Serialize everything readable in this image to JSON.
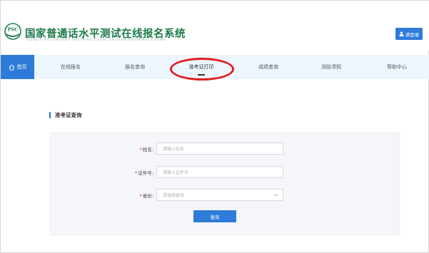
{
  "header": {
    "logo_text": "PSC",
    "title": "国家普通话水平测试在线报名系统",
    "subtitle": "GUOJIA PUTONGHUA SHUIPING CESHI ZAIXIAN BAOMING XITONG",
    "login_label": "请登录",
    "login_icon": "user-icon"
  },
  "nav": {
    "home": {
      "label": "首页",
      "icon": "home-icon"
    },
    "items": [
      {
        "label": "在线报名"
      },
      {
        "label": "报名查询"
      },
      {
        "label": "准考证打印"
      },
      {
        "label": "成绩查询"
      },
      {
        "label": "测前须知"
      },
      {
        "label": "帮助中心"
      }
    ],
    "active": "准考证打印"
  },
  "section": {
    "title": "准考证查询"
  },
  "form": {
    "name_label": "姓名:",
    "name_placeholder": "请输入姓名",
    "id_label": "证件号:",
    "id_placeholder": "请输入证件号",
    "province_label": "省份:",
    "province_placeholder": "请选择省份",
    "required_mark": "*",
    "submit_label": "查询"
  },
  "colors": {
    "brand_green": "#1d7a49",
    "primary_blue": "#2f7bd9",
    "nav_bg": "#eef6fd",
    "highlight_red": "#e02020"
  }
}
